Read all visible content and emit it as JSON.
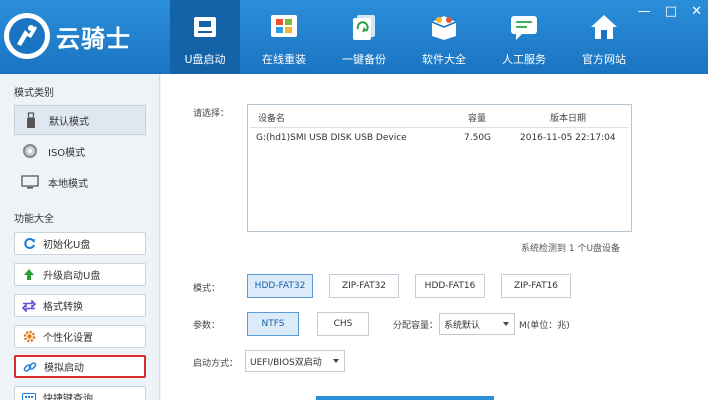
{
  "app": {
    "title": "云骑士"
  },
  "nav": [
    {
      "label": "U盘启动",
      "icon": "usb-drive-icon"
    },
    {
      "label": "在线重装",
      "icon": "windows-logo-icon"
    },
    {
      "label": "一键备份",
      "icon": "backup-document-icon"
    },
    {
      "label": "软件大全",
      "icon": "software-box-icon"
    },
    {
      "label": "人工服务",
      "icon": "chat-service-icon"
    },
    {
      "label": "官方网站",
      "icon": "home-icon"
    }
  ],
  "window_controls": [
    "—",
    "□",
    "✕"
  ],
  "sidebar": {
    "mode_title": "模式类别",
    "modes": [
      {
        "label": "默认模式",
        "icon": "usb-stick-icon"
      },
      {
        "label": "ISO模式",
        "icon": "disc-icon"
      },
      {
        "label": "本地模式",
        "icon": "monitor-icon"
      }
    ],
    "function_title": "功能大全",
    "functions": [
      {
        "label": "初始化U盘",
        "icon": "refresh-icon"
      },
      {
        "label": "升级启动U盘",
        "icon": "arrow-up-icon"
      },
      {
        "label": "格式转换",
        "icon": "swap-arrows-icon"
      },
      {
        "label": "个性化设置",
        "icon": "gear-icon"
      },
      {
        "label": "模拟启动",
        "icon": "link-icon"
      },
      {
        "label": "快捷键查询",
        "icon": "keyboard-icon"
      }
    ]
  },
  "main": {
    "select_label": "请选择：",
    "table_headers": [
      "设备名",
      "容量",
      "版本日期"
    ],
    "devices": [
      {
        "name": "G:(hd1)SMI USB DISK USB Device",
        "capacity": "7.50G",
        "date": "2016-11-05 22:17:04"
      }
    ],
    "status": "系统检测到 1 个U盘设备",
    "mode_label": "模式：",
    "modes": [
      "HDD-FAT32",
      "ZIP-FAT32",
      "HDD-FAT16",
      "ZIP-FAT16"
    ],
    "param_label": "参数：",
    "params": [
      "NTFS",
      "CHS"
    ],
    "alloc_label": "分配容量：",
    "alloc_value": "系统默认",
    "alloc_unit": "M(单位：兆)",
    "boot_label": "启动方式：",
    "boot_value": "UEFI/BIOS双启动"
  },
  "colors": {
    "header": "#2b8ed8",
    "header_active": "#1462a8",
    "highlight": "#d92b2b"
  }
}
